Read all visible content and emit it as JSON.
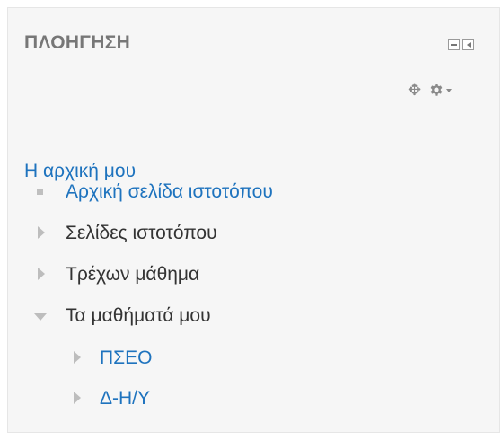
{
  "block": {
    "title": "ΠΛΟΗΓΗΣΗ",
    "controls": {
      "collapse_icon": "minus-box-icon",
      "dock_icon": "dock-left-icon"
    },
    "actions": {
      "move_icon": "move-icon",
      "settings_icon": "gear-icon"
    }
  },
  "navigation": {
    "root": "Η αρχική μου",
    "items": [
      {
        "label": "Αρχική σελίδα ιστοτόπου",
        "marker": "bullet",
        "link": true
      },
      {
        "label": "Σελίδες ιστοτόπου",
        "marker": "collapsed",
        "link": false
      },
      {
        "label": "Τρέχων μάθημα",
        "marker": "collapsed",
        "link": false
      },
      {
        "label": "Τα μαθήματά μου",
        "marker": "expanded",
        "link": false,
        "children": [
          {
            "label": "ΠΣΕΟ",
            "marker": "collapsed",
            "link": true
          },
          {
            "label": "Δ-Η/Υ",
            "marker": "collapsed",
            "link": true
          }
        ]
      }
    ]
  },
  "colors": {
    "link": "#1e73be",
    "text": "#333333",
    "title": "#777777",
    "background": "#f6f6f6",
    "marker": "#bdbdbd"
  }
}
